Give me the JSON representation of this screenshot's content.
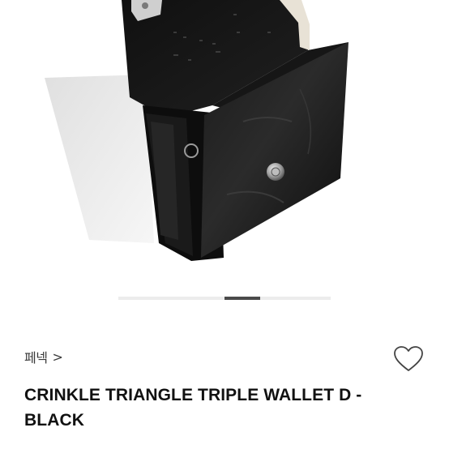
{
  "product": {
    "brand": "페넥",
    "brand_chevron": ">",
    "title": "CRINKLE TRIANGLE TRIPLE WALLET D - BLACK",
    "image_icon": "product-photo",
    "wishlist_icon": "heart-outline-icon",
    "image_pager": {
      "current": 4,
      "total": 6
    }
  },
  "colors": {
    "background": "#ffffff",
    "title_text": "#111111",
    "pager_track": "#ececec",
    "pager_thumb": "#4a4a4a"
  }
}
